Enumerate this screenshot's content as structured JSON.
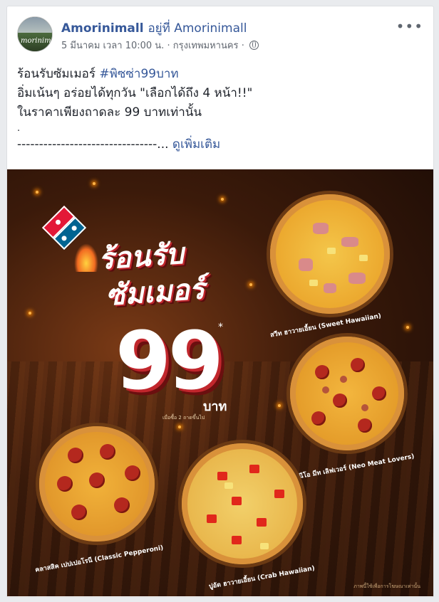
{
  "post": {
    "page_name": "Amorinimall",
    "at_text": "อยู่ที่ Amorinimall",
    "timestamp": "5 มีนาคม เวลา 10:00 น.",
    "separator": "·",
    "location": "กรุงเทพมหานคร",
    "separator2": "·",
    "more_options": "•••",
    "avatar_text": "morinimall",
    "text_line1_prefix": "ร้อนรับซัมเมอร์ ",
    "hashtag": "#พิซซ่า99บาท",
    "text_line2": "อิ่มเน้นๆ อร่อยได้ทุกวัน \"เลือกได้ถึง 4 หน้า!!\"",
    "text_line3": "ในราคาเพียงถาดละ 99 บาทเท่านั้น",
    "text_line4": ".",
    "divider_text": "--------------------------------...",
    "see_more": "ดูเพิ่มเติม"
  },
  "image": {
    "headline_1": "ร้อนรับ",
    "headline_2": "ซัมเมอร์",
    "price": "99",
    "price_star": "*",
    "currency": "บาท",
    "price_note": "เมื่อซื้อ 2 ถาดขึ้นไป",
    "pizzas": [
      {
        "name": "สวีท ฮาวายเอี้ยน (Sweet Hawaiian)"
      },
      {
        "name": "นีโอ มีท เลิฟเวอร์ (Neo Meat Lovers)"
      },
      {
        "name": "คลาสสิค เปปเปอโรนี (Classic Pepperoni)"
      },
      {
        "name": "ปูอัด ฮาวายเอี้ยน (Crab Hawaiian)"
      }
    ],
    "footnote": "ภาพนี้ใช้เพื่อการโฆษณาเท่านั้น"
  },
  "colors": {
    "link": "#365899",
    "brand_red": "#e31837",
    "brand_blue": "#006491"
  }
}
